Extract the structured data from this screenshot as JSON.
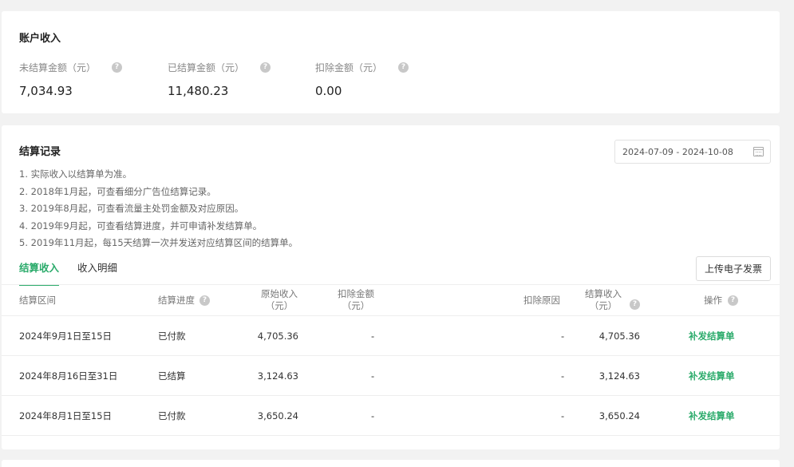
{
  "income_summary": {
    "title": "账户收入",
    "stats": [
      {
        "label": "未结算金额（元）",
        "value": "7,034.93",
        "help_icon": "question-circle-icon"
      },
      {
        "label": "已结算金额（元）",
        "value": "11,480.23",
        "help_icon": "question-circle-icon"
      },
      {
        "label": "扣除金额（元）",
        "value": "0.00",
        "help_icon": "question-circle-icon"
      }
    ]
  },
  "settlement": {
    "title": "结算记录",
    "date_range": "2024-07-09 - 2024-10-08",
    "notes": [
      "1. 实际收入以结算单为准。",
      "2. 2018年1月起，可查看细分广告位结算记录。",
      "3. 2019年8月起，可查看流量主处罚金额及对应原因。",
      "4. 2019年9月起，可查看结算进度，并可申请补发结算单。",
      "5. 2019年11月起，每15天结算一次并发送对应结算区间的结算单。"
    ],
    "tabs": [
      {
        "label": "结算收入",
        "active": true
      },
      {
        "label": "收入明细",
        "active": false
      }
    ],
    "upload_button": "上传电子发票",
    "columns": {
      "period": "结算区间",
      "progress": "结算进度",
      "original_income_1": "原始收入",
      "original_income_2": "（元）",
      "deduction_1": "扣除金额",
      "deduction_2": "（元）",
      "reason": "扣除原因",
      "settled_income_1": "结算收入",
      "settled_income_2": "（元）",
      "action": "操作"
    },
    "rows": [
      {
        "period": "2024年9月1日至15日",
        "progress": "已付款",
        "original": "4,705.36",
        "deduction": "-",
        "reason": "-",
        "settled": "4,705.36",
        "action": "补发结算单"
      },
      {
        "period": "2024年8月16日至31日",
        "progress": "已结算",
        "original": "3,124.63",
        "deduction": "-",
        "reason": "-",
        "settled": "3,124.63",
        "action": "补发结算单"
      },
      {
        "period": "2024年8月1日至15日",
        "progress": "已付款",
        "original": "3,650.24",
        "deduction": "-",
        "reason": "-",
        "settled": "3,650.24",
        "action": "补发结算单"
      }
    ]
  },
  "colors": {
    "accent": "#2bab6b",
    "muted": "#888888",
    "help_icon": "#c8c8c8"
  }
}
